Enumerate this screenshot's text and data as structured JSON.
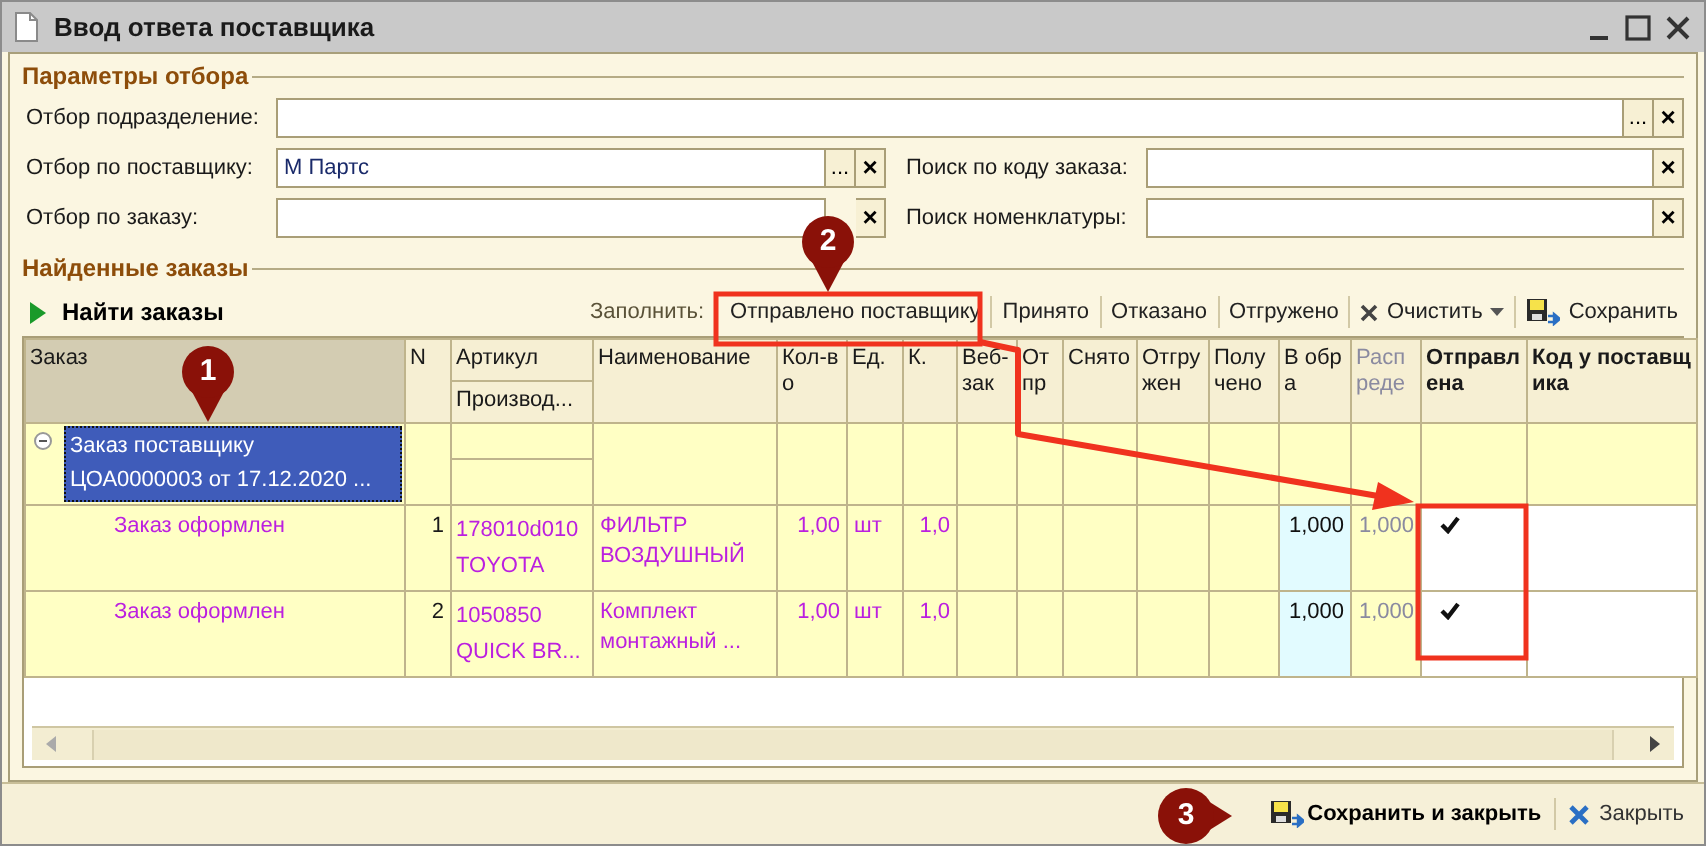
{
  "window": {
    "title": "Ввод ответа поставщика"
  },
  "filters": {
    "title": "Параметры отбора",
    "fields": [
      {
        "label": "Отбор подразделение:",
        "kind": "wide",
        "buttons": [
          "...",
          "×"
        ]
      },
      {
        "label": "Отбор по поставщику:",
        "value": "М Партс",
        "kind": "left",
        "buttons": [
          "...",
          "×"
        ]
      },
      {
        "label": "Поиск по коду заказа:",
        "kind": "right",
        "buttons": [
          "×"
        ]
      },
      {
        "label": "Отбор по заказу:",
        "kind": "left",
        "buttons": [
          "×"
        ]
      },
      {
        "label": "Поиск номенклатуры:",
        "kind": "right",
        "buttons": [
          "×"
        ]
      }
    ]
  },
  "orders": {
    "title": "Найденные заказы",
    "find_button": "Найти заказы",
    "fill_label": "Заполнить:",
    "toolbar": [
      {
        "label": "Отправлено поставщику",
        "kind": "plain"
      },
      {
        "label": "Принято",
        "kind": "plain"
      },
      {
        "label": "Отказано",
        "kind": "plain"
      },
      {
        "label": "Отгружено",
        "kind": "plain"
      },
      {
        "label": "Очистить",
        "kind": "clear"
      },
      {
        "label": "Сохранить",
        "kind": "save"
      }
    ],
    "columns": [
      {
        "label": "Заказ",
        "kind": "plain",
        "highlighted": true
      },
      {
        "label": "N",
        "kind": "plain",
        "highlighted": false
      },
      {
        "label": "Артикул",
        "sub_label": "Производ...",
        "kind": "plain",
        "highlighted": false
      },
      {
        "label": "Наименование",
        "kind": "plain",
        "highlighted": false
      },
      {
        "label": "Кол-во",
        "kind": "plain",
        "highlighted": false
      },
      {
        "label": "Ед.",
        "kind": "plain",
        "highlighted": false
      },
      {
        "label": "К.",
        "kind": "plain",
        "highlighted": false
      },
      {
        "label": "Веб-зак",
        "kind": "plain",
        "highlighted": false
      },
      {
        "label": "Отпр",
        "kind": "plain",
        "highlighted": false
      },
      {
        "label": "Снято",
        "kind": "plain",
        "highlighted": false
      },
      {
        "label": "Отгружен",
        "kind": "plain",
        "highlighted": false
      },
      {
        "label": "Получено",
        "kind": "plain",
        "highlighted": false
      },
      {
        "label": "В обра",
        "kind": "plain",
        "highlighted": false
      },
      {
        "label": "Распреде",
        "kind": "dim",
        "highlighted": false
      },
      {
        "label": "Отправлена",
        "kind": "bold",
        "highlighted": false
      },
      {
        "label": "Код у поставщика",
        "kind": "bold",
        "highlighted": false
      }
    ],
    "rows": [
      {
        "kind": "group",
        "expanded": true,
        "selected": true,
        "title": "Заказ поставщику\nЦОА0000003 от 17.12.2020 ..."
      },
      {
        "kind": "item",
        "selected": false,
        "status": "Заказ оформлен",
        "n": "1",
        "article": "178010d010",
        "maker": "TOYOTA",
        "name": "ФИЛЬТР ВОЗДУШНЫЙ",
        "qty": "1,00",
        "unit": "шт",
        "k": "1,0",
        "in_work": "1,000",
        "distributed": "1,000",
        "sent": true
      },
      {
        "kind": "item",
        "selected": false,
        "status": "Заказ оформлен",
        "n": "2",
        "article": "1050850",
        "maker": "QUICK BR...",
        "name": "Комплект монтажный ...",
        "qty": "1,00",
        "unit": "шт",
        "k": "1,0",
        "in_work": "1,000",
        "distributed": "1,000",
        "sent": true
      }
    ]
  },
  "footer": {
    "buttons": [
      {
        "label": "Сохранить и закрыть",
        "kind": "save"
      },
      {
        "label": "Закрыть",
        "kind": "close"
      }
    ]
  },
  "annotations": {
    "markers": [
      "1",
      "2",
      "3"
    ]
  }
}
